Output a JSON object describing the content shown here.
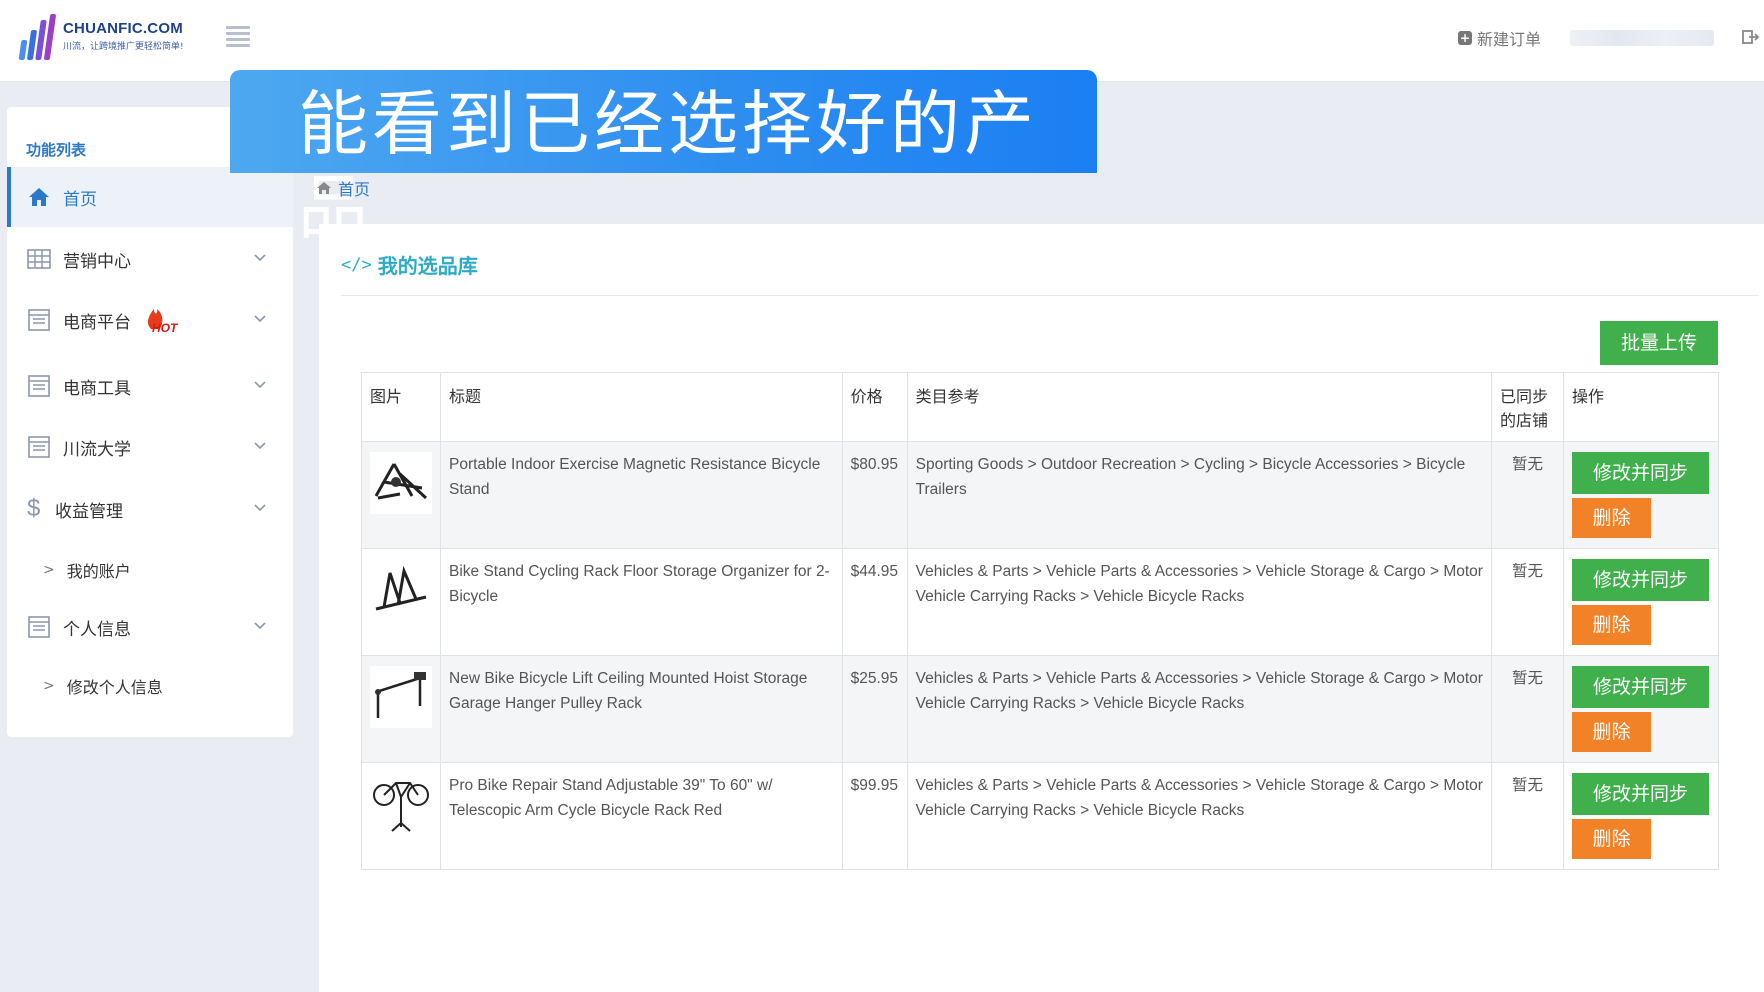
{
  "header": {
    "logo_name": "CHUANFIC.COM",
    "logo_slogan": "川流，让跨境推广更轻松简单!",
    "new_order_label": "新建订单"
  },
  "banner": {
    "text": "能看到已经选择好的产品"
  },
  "sidebar": {
    "title": "功能列表",
    "items": [
      {
        "label": "首页",
        "icon": "home-icon"
      },
      {
        "label": "营销中心",
        "icon": "table-icon"
      },
      {
        "label": "电商平台",
        "icon": "list-icon",
        "badge": "HOT"
      },
      {
        "label": "电商工具",
        "icon": "list-icon"
      },
      {
        "label": "川流大学",
        "icon": "list-icon"
      },
      {
        "label": "收益管理",
        "icon": "dollar-icon"
      },
      {
        "label": "个人信息",
        "icon": "list-icon"
      }
    ],
    "sub_items": [
      {
        "label": "我的账户"
      },
      {
        "label": "修改个人信息"
      }
    ]
  },
  "breadcrumb": {
    "home_label": "首页"
  },
  "panel": {
    "title": "我的选品库",
    "bulk_upload_label": "批量上传",
    "columns": [
      "图片",
      "标题",
      "价格",
      "类目参考",
      "已同步的店铺",
      "操作"
    ],
    "edit_label": "修改并同步",
    "delete_label": "删除",
    "rows": [
      {
        "title": "Portable Indoor Exercise Magnetic Resistance Bicycle Stand",
        "price": "$80.95",
        "category": "Sporting Goods > Outdoor Recreation > Cycling > Bicycle Accessories > Bicycle Trailers",
        "synced": "暂无"
      },
      {
        "title": "Bike Stand Cycling Rack Floor Storage Organizer for 2-Bicycle",
        "price": "$44.95",
        "category": "Vehicles & Parts > Vehicle Parts & Accessories > Vehicle Storage & Cargo > Motor Vehicle Carrying Racks > Vehicle Bicycle Racks",
        "synced": "暂无"
      },
      {
        "title": "New Bike Bicycle Lift Ceiling Mounted Hoist Storage Garage Hanger Pulley Rack",
        "price": "$25.95",
        "category": "Vehicles & Parts > Vehicle Parts & Accessories > Vehicle Storage & Cargo > Motor Vehicle Carrying Racks > Vehicle Bicycle Racks",
        "synced": "暂无"
      },
      {
        "title": "Pro Bike Repair Stand Adjustable 39\" To 60\" w/ Telescopic Arm Cycle Bicycle Rack Red",
        "price": "$99.95",
        "category": "Vehicles & Parts > Vehicle Parts & Accessories > Vehicle Storage & Cargo > Motor Vehicle Carrying Racks > Vehicle Bicycle Racks",
        "synced": "暂无"
      }
    ]
  },
  "colors": {
    "accent_blue": "#2d79c9",
    "title_teal": "#2dabc6",
    "green": "#3fb04b",
    "orange": "#f28228",
    "banner_blue": "#2f8ff0"
  }
}
